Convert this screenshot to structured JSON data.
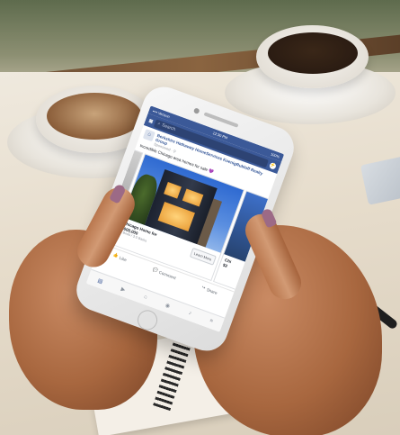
{
  "status_bar": {
    "time": "12:30 PM",
    "carrier": "•••• Verizon",
    "battery": "100%"
  },
  "header": {
    "search_placeholder": "Search"
  },
  "post": {
    "page_name": "Berkshire Hathaway HomeServices KoenigRubloff Realty Group",
    "meta": "Sponsored · ⚲",
    "text": "Incredible Chicago area homes for sale",
    "emoji": "💜"
  },
  "carousel": {
    "main_card": {
      "title": "Chicago Home for",
      "price": "$000,000",
      "sub": "4 Beds / 3.5 Baths",
      "button": "Learn More"
    },
    "right_card": {
      "title": "Chi",
      "price": "$2"
    },
    "left_card": {
      "title": "...",
      "price": ""
    }
  },
  "actions": {
    "like": "Like",
    "comment": "Comment",
    "share": "Share"
  },
  "icons": [
    "camera-icon",
    "search-icon",
    "messenger-icon",
    "like-icon",
    "comment-icon",
    "share-icon",
    "news-feed-icon",
    "video-icon",
    "marketplace-icon",
    "groups-icon",
    "notifications-icon",
    "menu-icon"
  ],
  "colors": {
    "facebook_blue": "#3b5998",
    "link_blue": "#365899"
  }
}
